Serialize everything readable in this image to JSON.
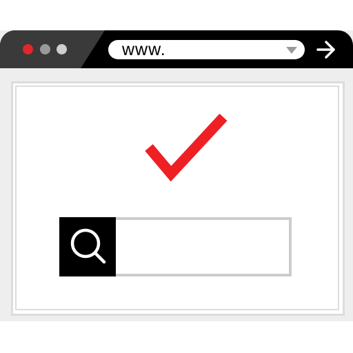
{
  "window": {
    "controls": {
      "close_color": "#e3262b",
      "minimize_color": "#9a9a9a",
      "maximize_color": "#cfcfcf"
    },
    "address_bar": {
      "value": "www.",
      "dropdown_icon": "triangle-down-icon"
    },
    "go_icon": "arrow-right-icon"
  },
  "content": {
    "status_icon": "checkmark-icon",
    "status_color": "#ee2024"
  },
  "search": {
    "icon": "search-icon",
    "value": ""
  }
}
